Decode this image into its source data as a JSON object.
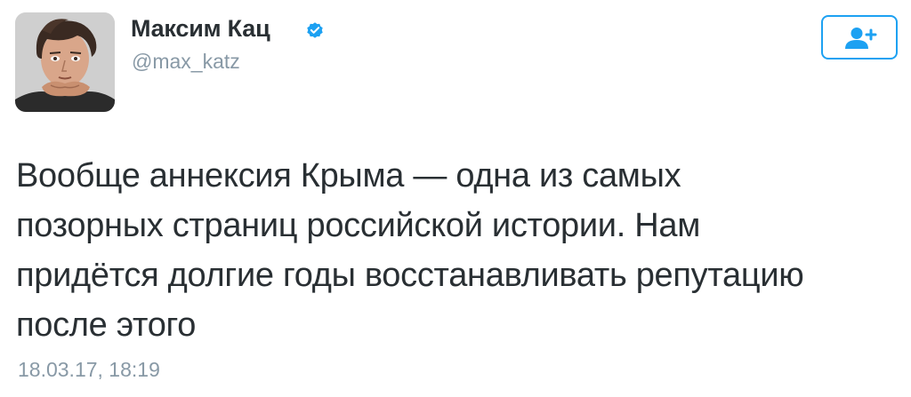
{
  "author": {
    "display_name": "Максим Кац",
    "handle": "@max_katz",
    "verified": true,
    "avatar_icon": "cartoon-portrait-avatar"
  },
  "follow_button": {
    "icon": "add-user-icon",
    "color": "#1da1f2"
  },
  "tweet": {
    "text_lines": [
      "Вообще аннексия Крыма — одна из самых",
      "позорных страниц российской истории. Нам",
      "придётся долгие годы восстанавливать репутацию",
      "после этого"
    ],
    "timestamp": "18.03.17, 18:19"
  },
  "colors": {
    "text": "#292f33",
    "muted": "#8899a6",
    "accent": "#1da1f2"
  }
}
